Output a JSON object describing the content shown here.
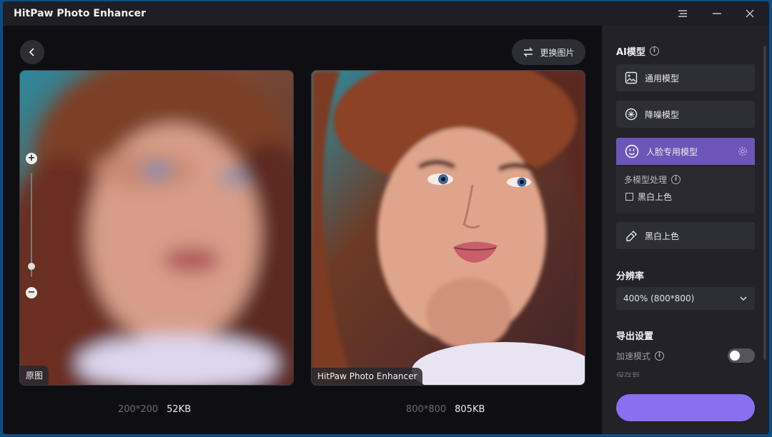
{
  "app": {
    "title": "HitPaw Photo Enhancer"
  },
  "toolbar": {
    "change_image_label": "更换图片"
  },
  "preview": {
    "left": {
      "label": "原图",
      "dimensions": "200*200",
      "size": "52KB"
    },
    "right": {
      "label": "HitPaw Photo Enhancer",
      "dimensions": "800*800",
      "size": "805KB"
    }
  },
  "sidebar": {
    "ai_model_title": "AI模型",
    "models": [
      {
        "label": "通用模型",
        "icon": "image-icon"
      },
      {
        "label": "降噪模型",
        "icon": "denoise-icon"
      },
      {
        "label": "人脸专用模型",
        "icon": "face-icon",
        "active": true
      },
      {
        "label": "黑白上色",
        "icon": "colorize-icon"
      }
    ],
    "multi_model": {
      "label": "多模型处理",
      "option": "黑白上色"
    },
    "resolution_title": "分辨率",
    "resolution_value": "400% (800*800)",
    "export_title": "导出设置",
    "accelerate_label": "加速模式",
    "save_to_label": "保存到",
    "export_button_label": ""
  },
  "colors": {
    "accent": "#6e55b8",
    "export": "#8a6ff0",
    "background": "#16161b"
  }
}
